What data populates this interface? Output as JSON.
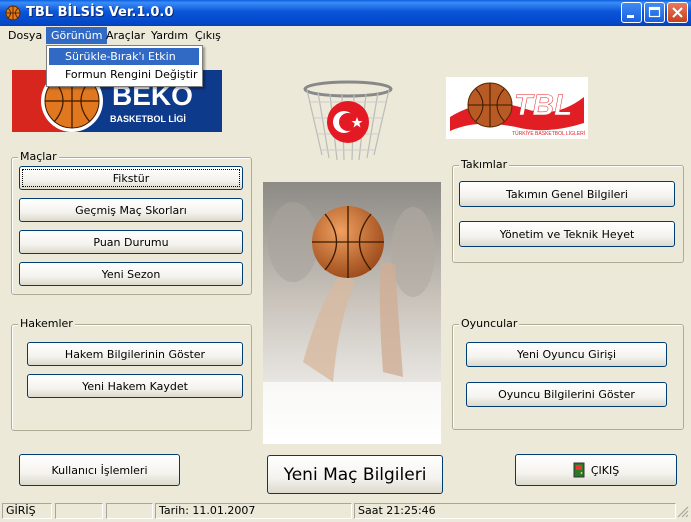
{
  "window": {
    "title": "TBL BİLSİS Ver.1.0.0"
  },
  "menu": {
    "items": [
      "Dosya",
      "Görünüm",
      "Araçlar",
      "Yardım",
      "Çıkış"
    ],
    "dropdown": [
      "Sürükle-Bırak'ı Etkin",
      "Formun Rengini Değiştir"
    ]
  },
  "logos": {
    "beko_main": "BEKO",
    "beko_sub": "BASKETBOL LİGİ",
    "tbl_main": "TBL",
    "tbl_sub": "TÜRKİYE BASKETBOL LİGLERİ"
  },
  "groups": {
    "maclar": {
      "label": "Maçlar",
      "buttons": [
        "Fikstür",
        "Geçmiş Maç Skorları",
        "Puan Durumu",
        "Yeni Sezon"
      ]
    },
    "takimlar": {
      "label": "Takımlar",
      "buttons": [
        "Takımın Genel Bilgileri",
        "Yönetim ve Teknik Heyet"
      ]
    },
    "hakemler": {
      "label": "Hakemler",
      "buttons": [
        "Hakem Bilgilerinin Göster",
        "Yeni Hakem Kaydet"
      ]
    },
    "oyuncular": {
      "label": "Oyuncular",
      "buttons": [
        "Yeni Oyuncu Girişi",
        "Oyuncu Bilgilerini Göster"
      ]
    }
  },
  "bottom": {
    "kullanici": "Kullanıcı İşlemleri",
    "yeni_mac": "Yeni Maç Bilgileri",
    "cikis": "ÇIKIŞ"
  },
  "status": {
    "mode": "GİRİŞ",
    "empty1": "",
    "empty2": "",
    "date": "Tarih: 11.01.2007",
    "time": "Saat 21:25:46"
  },
  "colors": {
    "title_bar": "#0a55d8",
    "menu_highlight": "#316ac5",
    "window_bg": "#ece9d8",
    "tbl_red": "#e01e24",
    "beko_blue": "#0e3a8c"
  }
}
